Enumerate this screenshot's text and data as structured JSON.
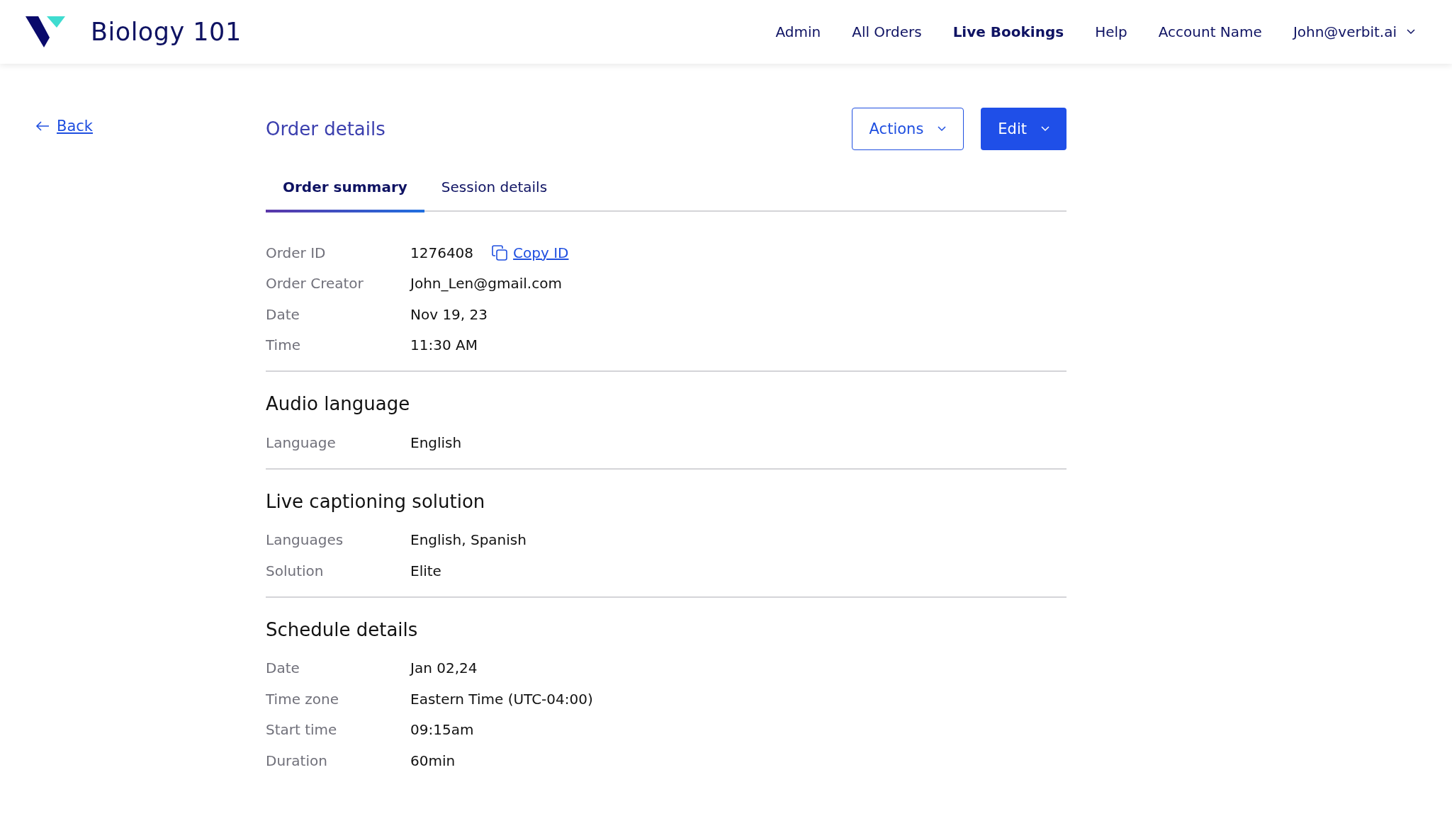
{
  "header": {
    "title": "Biology 101",
    "nav": [
      {
        "label": "Admin",
        "selected": false
      },
      {
        "label": "All Orders",
        "selected": false
      },
      {
        "label": "Live Bookings",
        "selected": true
      },
      {
        "label": "Help",
        "selected": false
      },
      {
        "label": "Account Name",
        "selected": false
      }
    ],
    "user_menu": "John@verbit.ai"
  },
  "back_link": "Back",
  "page_title": "Order details",
  "buttons": [
    {
      "label": "Actions",
      "kind": "outline"
    },
    {
      "label": "Edit",
      "kind": "primary"
    }
  ],
  "tabs": [
    {
      "label": "Order summary",
      "selected": true
    },
    {
      "label": "Session details",
      "selected": false
    }
  ],
  "sections": [
    {
      "rows": [
        {
          "label": "Order ID",
          "value": "1276408",
          "link": "Copy ID"
        },
        {
          "label": "Order Creator",
          "value": "John_Len@gmail.com"
        },
        {
          "label": "Date",
          "value": "Nov 19, 23"
        },
        {
          "label": "Time",
          "value": "11:30 AM"
        }
      ]
    },
    {
      "heading": "Audio language",
      "rows": [
        {
          "label": "Language",
          "value": "English"
        }
      ]
    },
    {
      "heading": "Live captioning solution",
      "rows": [
        {
          "label": "Languages",
          "value": "English, Spanish"
        },
        {
          "label": "Solution",
          "value": "Elite"
        }
      ]
    },
    {
      "heading": "Schedule details",
      "rows": [
        {
          "label": "Date",
          "value": "Jan 02,24"
        },
        {
          "label": "Time zone",
          "value": "Eastern Time (UTC-04:00)"
        },
        {
          "label": "Start time",
          "value": "09:15am"
        },
        {
          "label": "Duration",
          "value": "60min"
        }
      ]
    }
  ]
}
